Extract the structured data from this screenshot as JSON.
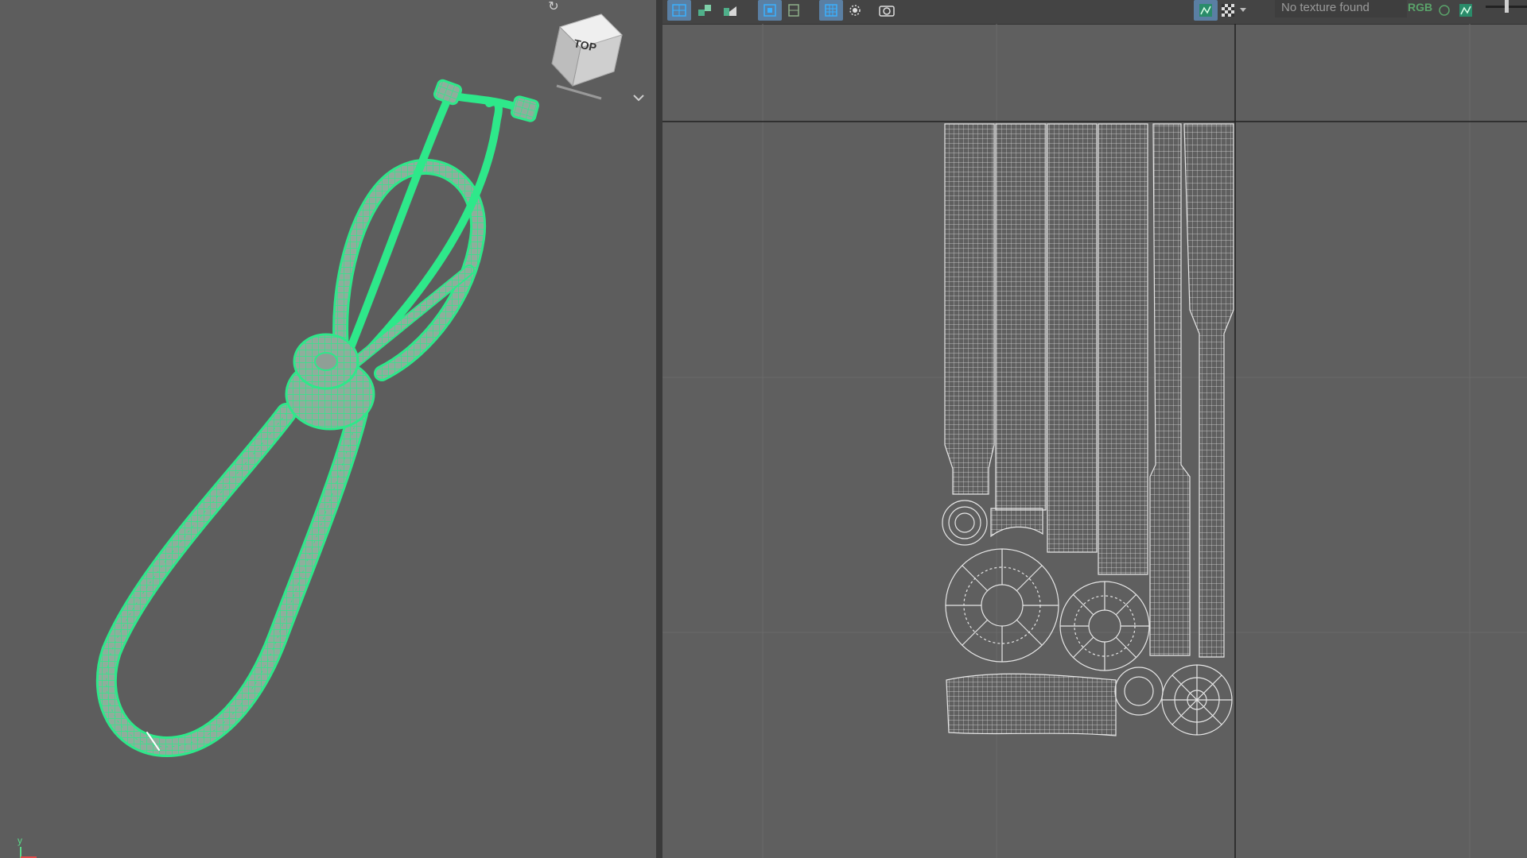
{
  "viewport": {
    "viewcube_face": "TOP",
    "home_icon": "home-icon",
    "menu_icon": "chevron-down-icon",
    "axis_label": "y"
  },
  "uv_toolbar": {
    "buttons": [
      "uv-grid-icon",
      "uv-layout-icon",
      "uv-checker-icon",
      "uv-shell-icon",
      "uv-border-icon",
      "uv-distortion-icon",
      "uv-isolate-icon",
      "camera-icon"
    ],
    "texture_status": "No texture found",
    "channel_label": "RGB",
    "toggle_icons": [
      "image-display-icon",
      "checker-display-icon",
      "dropdown-icon",
      "rgb-icon",
      "image-icon"
    ]
  },
  "colors": {
    "wireframe_selected": "#2ee88a",
    "wire_uv": "#dcdcdc",
    "background": "#5d5d5d",
    "toolbar_active": "#5a7fa3"
  }
}
